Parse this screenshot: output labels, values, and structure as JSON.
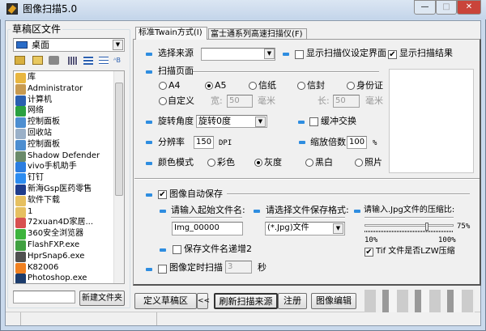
{
  "window": {
    "title": "图像扫描5.0",
    "minimize": "—",
    "maximize": "□",
    "close": "✕"
  },
  "left": {
    "group_label": "草稿区文件",
    "location": "桌面",
    "toolbar": [
      "up-folder-icon",
      "open-folder-icon",
      "print-icon",
      "grid-view-icon",
      "list-view-icon",
      "detail-view-icon",
      "sort-icon"
    ],
    "files": [
      {
        "name": "库",
        "color": "#e8b640"
      },
      {
        "name": "Administrator",
        "color": "#c89a50"
      },
      {
        "name": "计算机",
        "color": "#2a5fb0"
      },
      {
        "name": "网络",
        "color": "#2aa040"
      },
      {
        "name": "控制面板",
        "color": "#4d8ed0"
      },
      {
        "name": "回收站",
        "color": "#9ab0c8"
      },
      {
        "name": "控制面板",
        "color": "#4d8ed0"
      },
      {
        "name": "Shadow Defender",
        "color": "#6a8a6a"
      },
      {
        "name": "vivo手机助手",
        "color": "#2b7de0"
      },
      {
        "name": "钉钉",
        "color": "#2c8cf0"
      },
      {
        "name": "新海Gsp医药零售",
        "color": "#1e3c8c"
      },
      {
        "name": "软件下载",
        "color": "#e6c060"
      },
      {
        "name": "1",
        "color": "#e6c060"
      },
      {
        "name": "72xuan4D家居...",
        "color": "#d85050"
      },
      {
        "name": "360安全浏览器",
        "color": "#3cb43c"
      },
      {
        "name": "FlashFXP.exe",
        "color": "#40a040"
      },
      {
        "name": "HprSnap6.exe",
        "color": "#505050"
      },
      {
        "name": "K82006",
        "color": "#f08020"
      },
      {
        "name": "Photoshop.exe",
        "color": "#1c3c6c"
      }
    ],
    "new_folder_input": "",
    "new_folder_button": "新建文件夹"
  },
  "tabs": [
    {
      "label": "标准Twain方式(I)",
      "active": true
    },
    {
      "label": "富士通系列高速扫描仪(F)",
      "active": false
    }
  ],
  "scan": {
    "source_label": "选择来源",
    "source_value": "",
    "show_settings_label": "显示扫描仪设定界面",
    "show_settings": false,
    "show_result_label": "显示扫描结果",
    "show_result": true,
    "page_label": "扫描页面",
    "pages": [
      {
        "label": "A4",
        "on": false
      },
      {
        "label": "A5",
        "on": true
      },
      {
        "label": "信纸",
        "on": false
      },
      {
        "label": "信封",
        "on": false
      },
      {
        "label": "身份证",
        "on": false
      }
    ],
    "custom_label": "自定义",
    "custom_on": false,
    "width_label": "宽:",
    "width_value": "50",
    "height_label": "长:",
    "height_value": "50",
    "unit": "毫米",
    "rotate_label": "旋转角度",
    "rotate_value": "旋转0度",
    "buffer_label": "缓冲交换",
    "buffer": false,
    "dpi_label": "分辨率",
    "dpi_value": "150",
    "dpi_unit": "DPI",
    "zoom_label": "缩放倍数",
    "zoom_value": "100",
    "zoom_unit": "%",
    "color_label": "颜色模式",
    "colors": [
      {
        "label": "彩色",
        "on": false
      },
      {
        "label": "灰度",
        "on": true
      },
      {
        "label": "黑白",
        "on": false
      },
      {
        "label": "照片",
        "on": false
      }
    ]
  },
  "save": {
    "auto_label": "图像自动保存",
    "auto": true,
    "start_name_label": "请输入起始文件名:",
    "start_name": "Img_00000",
    "format_label": "请选择文件保存格式:",
    "format_value": "(*.Jpg)文件",
    "jpg_label": "请输入.Jpg文件的压缩比:",
    "jpg_ratio": 75,
    "jpg_ratio_text": "75%",
    "min": "10%",
    "max": "100%",
    "tif_label": "Tif 文件是否LZW压缩",
    "tif": true,
    "increment_label": "保存文件名递增2",
    "increment": false,
    "timer_label": "图像定时扫描",
    "timer": false,
    "timer_value": "3",
    "timer_unit": "秒"
  },
  "buttons": {
    "define": "定义草稿区",
    "collapse": "<<",
    "refresh": "刷新扫描来源",
    "register": "注册",
    "edit": "图像编辑"
  },
  "colors": {
    "accent": "#2e8de0",
    "titlebar": "#c4d5ea",
    "close": "#c9443a"
  }
}
